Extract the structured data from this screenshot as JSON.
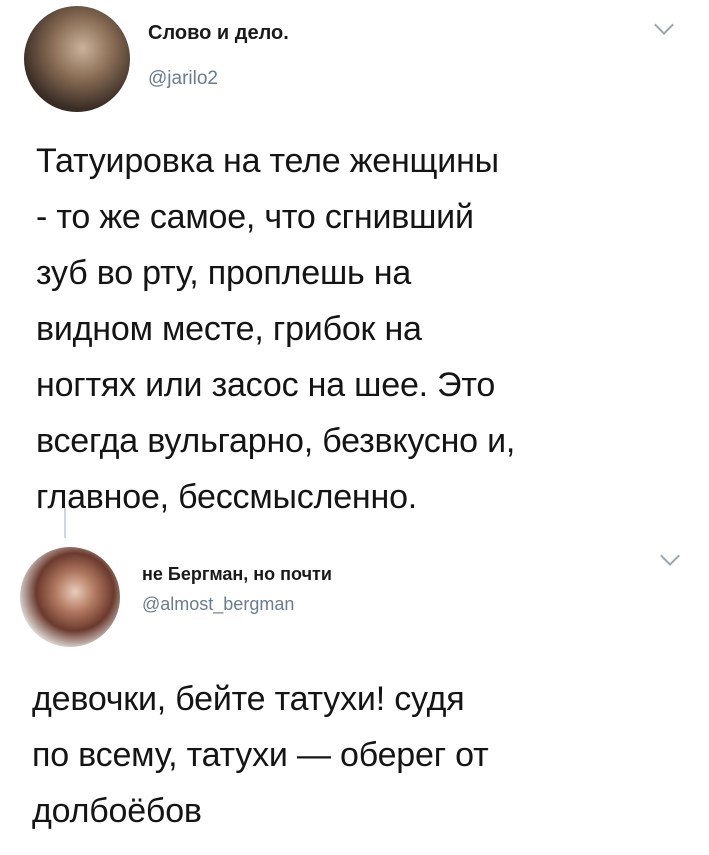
{
  "tweet1": {
    "display_name": "Слово и дело.",
    "handle": "@jarilo2",
    "lines": [
      "Татуировка на теле женщины",
      "- то же самое, что сгнивший",
      "зуб во рту, проплешь на",
      "видном месте, грибок на",
      "ногтях или засос на шее. Это",
      "всегда вульгарно, безвкусно и,",
      "главное, бессмысленно."
    ]
  },
  "tweet2": {
    "display_name": "не Бергман, но почти",
    "handle": "@almost_bergman",
    "lines": [
      "девочки, бейте татухи! судя",
      "по всему, татухи — оберег от",
      "долбоёбов"
    ]
  }
}
